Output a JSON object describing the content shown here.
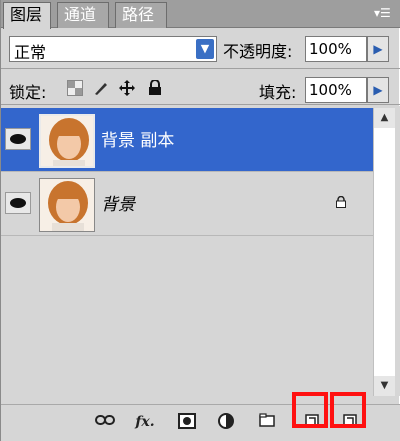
{
  "tabs": [
    {
      "label": "图层",
      "active": true
    },
    {
      "label": "通道",
      "active": false
    },
    {
      "label": "路径",
      "active": false
    }
  ],
  "panel_menu_icon": "panel-menu-icon",
  "blend_mode": {
    "value": "正常"
  },
  "opacity": {
    "label": "不透明度:",
    "value": "100%"
  },
  "lock": {
    "label": "锁定:",
    "icons": [
      "lock-transparent-pixels-icon",
      "lock-image-pixels-icon",
      "lock-position-icon",
      "lock-all-icon"
    ]
  },
  "fill": {
    "label": "填充:",
    "value": "100%"
  },
  "layers": [
    {
      "name": "背景 副本",
      "selected": true,
      "visible": true,
      "locked": false
    },
    {
      "name": "背景",
      "selected": false,
      "visible": true,
      "locked": true
    }
  ],
  "bottom_toolbar": {
    "icons": [
      "link-layers-icon",
      "fx-icon",
      "layer-mask-icon",
      "adjustment-layer-icon",
      "new-group-icon",
      "new-layer-icon",
      "delete-layer-icon"
    ],
    "fx_label": "fx."
  },
  "colors": {
    "selection": "#3366cc",
    "highlight": "#ff1010",
    "panel": "#d6d6d6"
  }
}
